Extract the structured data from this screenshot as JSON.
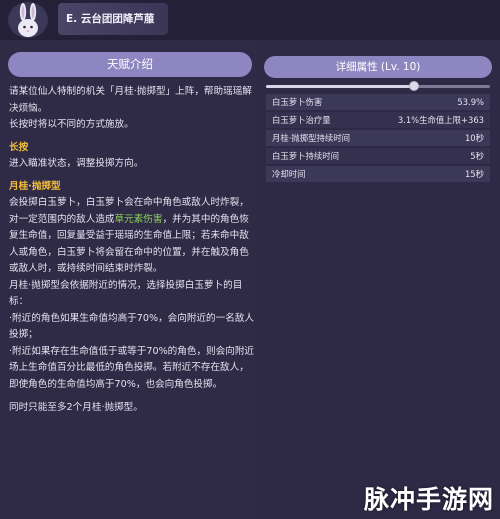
{
  "header": {
    "character_title": "E. 云台团团降芦菔",
    "avatar_icon": "rabbit-icon"
  },
  "talent_panel": {
    "title": "天赋介绍",
    "intro": "请某位仙人特制的机关「月桂·抛掷型」上阵，帮助瑶瑶解决烦恼。",
    "intro2": "长按时将以不同的方式施放。",
    "hold_title": "长按",
    "hold_desc": "进入瞄准状态，调整投掷方向。",
    "mode_title": "月桂·抛掷型",
    "mode_desc_a": "会投掷白玉萝卜，白玉萝卜会在命中角色或敌人时炸裂，对一定范围内的敌人造成",
    "mode_desc_dmg": "草元素伤害",
    "mode_desc_b": "，并为其中的角色恢复生命值，回复量受益于瑶瑶的生命值上限；若未命中敌人或角色，白玉萝卜将会留在命中的位置，并在触及角色或敌人时，或持续时间结束时炸裂。",
    "targeting_1": "月桂·抛掷型会依据附近的情况，选择投掷白玉萝卜的目标：",
    "targeting_2": "·附近的角色如果生命值均高于70%，会向附近的一名敌人投掷；",
    "targeting_3": "·附近如果存在生命值低于或等于70%的角色，则会向附近场上生命值百分比最低的角色投掷。若附近不存在敌人，即使角色的生命值均高于70%，也会向角色投掷。",
    "footer": "同时只能至多2个月桂·抛掷型。"
  },
  "attributes_panel": {
    "title": "详细属性 (Lv. 10)",
    "level_fraction": 0.66,
    "rows": [
      {
        "label": "白玉萝卜伤害",
        "value": "53.9%"
      },
      {
        "label": "白玉萝卜治疗量",
        "value": "3.1%生命值上限+363"
      },
      {
        "label": "月桂·抛掷型持续时间",
        "value": "10秒"
      },
      {
        "label": "白玉萝卜持续时间",
        "value": "5秒"
      },
      {
        "label": "冷却时间",
        "value": "15秒"
      }
    ]
  },
  "watermark": {
    "text": "脉冲手游网"
  },
  "colors": {
    "background": "#2e2a46",
    "header_pill": "#8e86c0",
    "section_title": "#f2bd3a",
    "dendro": "#8cd35a"
  }
}
